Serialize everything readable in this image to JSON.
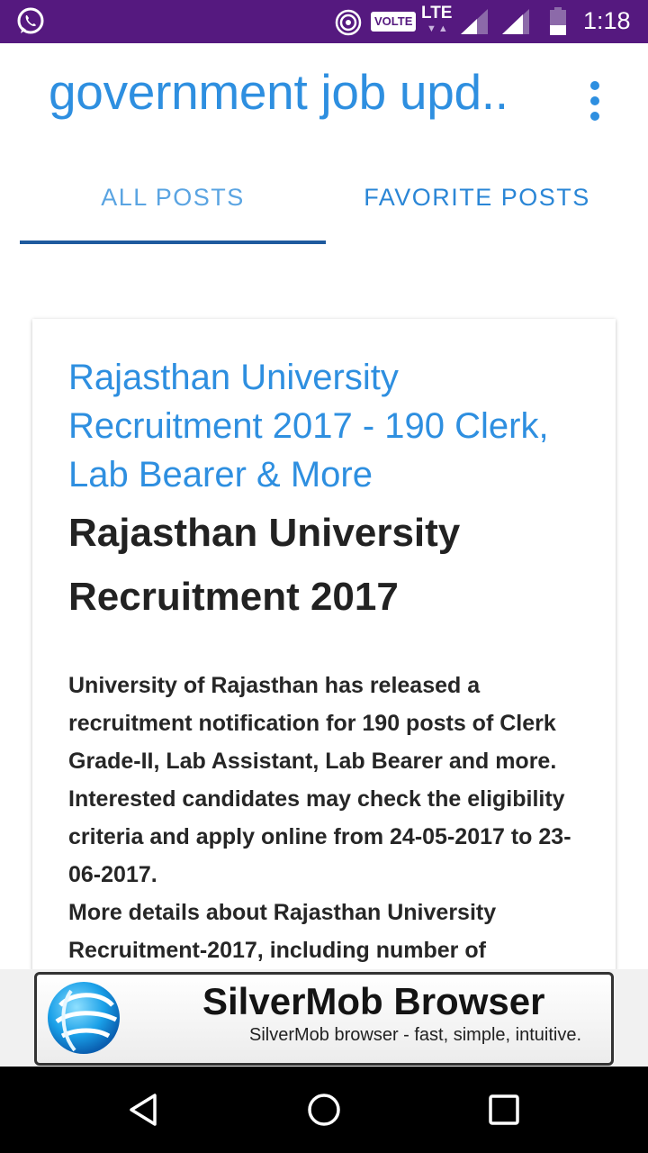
{
  "status_bar": {
    "time": "1:18",
    "network_badge": "VOLTE",
    "network_type": "LTE",
    "lte_arrows": "▼▲",
    "icons": [
      "whatsapp-icon",
      "hotspot-icon",
      "signal-icon",
      "signal-icon",
      "battery-icon"
    ],
    "background": "#55197f"
  },
  "toolbar": {
    "title": "government job upd..",
    "menu_icon": "overflow-menu-icon",
    "accent": "#2e8fe0"
  },
  "tabs": {
    "all_posts": "ALL POSTS",
    "favorite_posts": "FAVORITE POSTS",
    "selected": "ALL POSTS"
  },
  "post": {
    "title": "Rajasthan University Recruitment 2017 - 190 Clerk, Lab Bearer & More",
    "heading": "Rajasthan University Recruitment 2017",
    "body": "University of Rajasthan has released a recruitment notification for 190 posts of Clerk Grade-II, Lab Assistant, Lab Bearer and more. Interested candidates may check the eligibility criteria and apply online from 24-05-2017 to 23-06-2017.",
    "body_more": "More details about Rajasthan University Recruitment-2017, including number of"
  },
  "ad": {
    "title": "SilverMob Browser",
    "subtitle": "SilverMob browser - fast, simple, intuitive.",
    "logo_icon": "silvermob-logo-icon"
  },
  "nav_bar": {
    "buttons": [
      "back-icon",
      "home-icon",
      "recent-apps-icon"
    ]
  }
}
